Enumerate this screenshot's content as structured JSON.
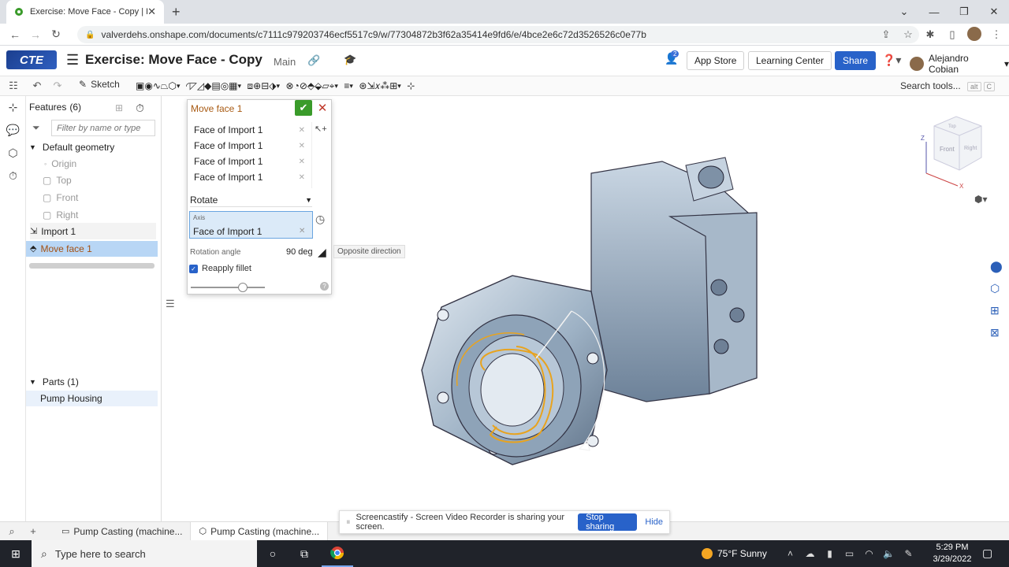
{
  "browser": {
    "tab_title": "Exercise: Move Face - Copy | Pum",
    "url": "valverdehs.onshape.com/documents/c7111c979203746ecf5517c9/w/77304872b3f62a35414e9fd6/e/4bce2e6c72d3526526c0e77b"
  },
  "header": {
    "logo_text": "CTE",
    "doc_title": "Exercise: Move Face - Copy",
    "branch": "Main",
    "notification_count": "2",
    "app_store": "App Store",
    "learning_center": "Learning Center",
    "share": "Share",
    "user_name": "Alejandro Cobian"
  },
  "toolbar": {
    "sketch_label": "Sketch",
    "search_label": "Search tools...",
    "shortcut_key1": "alt",
    "shortcut_key2": "C"
  },
  "features": {
    "title": "Features",
    "count": "(6)",
    "filter_placeholder": "Filter by name or type",
    "default_geometry": "Default geometry",
    "items": [
      "Origin",
      "Top",
      "Front",
      "Right"
    ],
    "import": "Import 1",
    "selected": "Move face 1"
  },
  "parts": {
    "title": "Parts (1)",
    "item": "Pump Housing"
  },
  "dialog": {
    "title": "Move face 1",
    "faces": [
      "Face of Import 1",
      "Face of Import 1",
      "Face of Import 1",
      "Face of Import 1"
    ],
    "mode": "Rotate",
    "axis_label": "Axis",
    "axis_value": "Face of Import 1",
    "rotation_label": "Rotation angle",
    "rotation_value": "90 deg",
    "tooltip": "Opposite direction",
    "reapply_fillet": "Reapply fillet",
    "reapply_checked": true
  },
  "viewcube": {
    "top": "Top",
    "front": "Front",
    "right": "Right",
    "axis_z": "Z",
    "axis_x": "X"
  },
  "bottom_tabs": [
    "Pump Casting (machine...",
    "Pump Casting (machine..."
  ],
  "screencast": {
    "message": "Screencastify - Screen Video Recorder is sharing your screen.",
    "stop": "Stop sharing",
    "hide": "Hide"
  },
  "taskbar": {
    "search_placeholder": "Type here to search",
    "weather": "75°F  Sunny",
    "time": "5:29 PM",
    "date": "3/29/2022"
  },
  "colors": {
    "accent": "#2862c9",
    "selection": "#b8d6f5",
    "confirm": "#3a9b2a",
    "highlight_edge": "#e8a31e"
  }
}
